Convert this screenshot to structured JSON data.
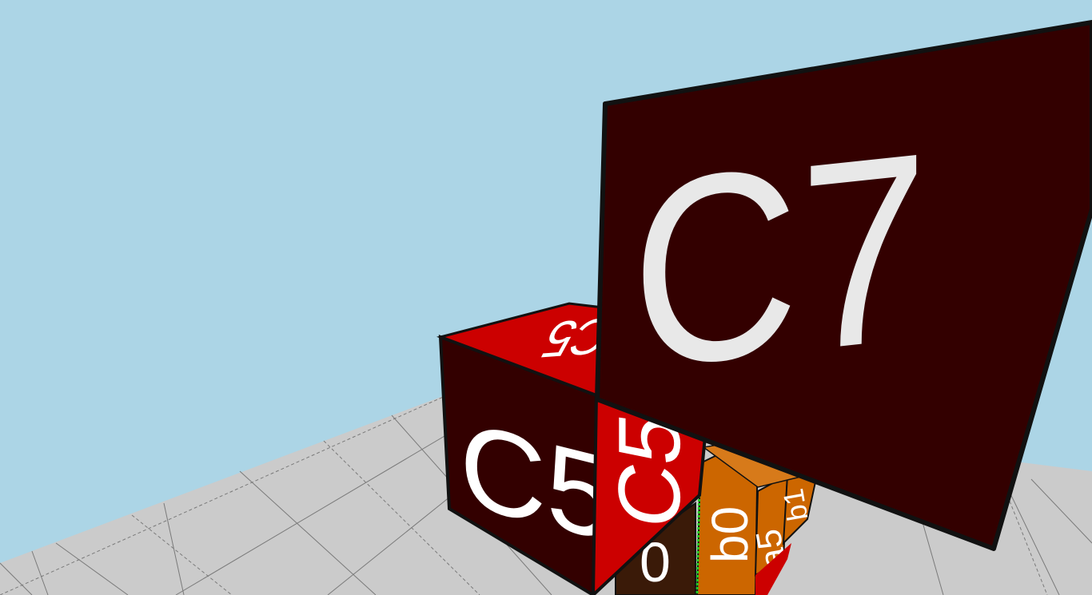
{
  "scene": {
    "sky_color": "#acd5e6",
    "floor_color": "#cbcbcb",
    "grid_line_color": "#7a7a7a"
  },
  "blocks": {
    "c7": {
      "label": "C7",
      "face_color": "#330000",
      "text_color": "#e8e8e8"
    },
    "c5_left": {
      "label": "C5",
      "face_color": "#330000",
      "text_color": "#ffffff"
    },
    "c5_top": {
      "label": "C5",
      "face_color": "#cc0000",
      "text_color": "#ffffff"
    },
    "c5_front": {
      "label": "C5",
      "face_color": "#cc0000",
      "text_color": "#ffffff"
    },
    "b0": {
      "label": "b0",
      "face_color": "#cc6600",
      "text_color": "#ffffff"
    },
    "b1": {
      "label": "b1",
      "face_color": "#cc6600",
      "text_color": "#ffffff"
    },
    "a5": {
      "label": "a5",
      "face_color": "#cc6600",
      "text_color": "#ffffff"
    },
    "dark_lower": {
      "label": "0",
      "face_color": "#3a1a08",
      "text_color": "#ffffff"
    }
  }
}
